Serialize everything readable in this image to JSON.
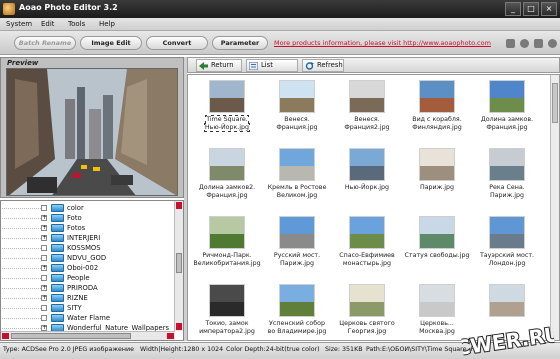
{
  "window": {
    "title": "Aoao Photo Editor 3.2",
    "buttons": [
      "_",
      "□",
      "×"
    ]
  },
  "menu": [
    "System",
    "Edit",
    "Tools",
    "Help"
  ],
  "toolbar": {
    "batch_rename": "Batch Rename",
    "image_edit": "Image Edit",
    "convert": "Convert",
    "parameter": "Parameter",
    "promo_link": "More products information, please visit http://www.aoaophoto.com",
    "icons": [
      "lock-icon",
      "person-icon",
      "home-icon",
      "help-icon"
    ]
  },
  "preview": {
    "label": "Preview"
  },
  "tree": {
    "items": [
      {
        "label": "color",
        "expander": ""
      },
      {
        "label": "Foto",
        "expander": "+"
      },
      {
        "label": "Fotos",
        "expander": "+"
      },
      {
        "label": "INTERJERI",
        "expander": "+"
      },
      {
        "label": "KOSSMOS",
        "expander": ""
      },
      {
        "label": "NDVU_GOD",
        "expander": ""
      },
      {
        "label": "Oboi-002",
        "expander": "+"
      },
      {
        "label": "People",
        "expander": ""
      },
      {
        "label": "PRIRODA",
        "expander": "+"
      },
      {
        "label": "RIZNE",
        "expander": "+"
      },
      {
        "label": "SITY",
        "expander": ""
      },
      {
        "label": "Water Flame",
        "expander": ""
      },
      {
        "label": "Wonderful_Nature_Wallpapers",
        "expander": "+"
      }
    ]
  },
  "browser": {
    "return_label": "Return",
    "list_label": "List",
    "refresh_label": "Refresh"
  },
  "thumbnails": [
    {
      "caption": "Time Square.\nНью-Йорк.jpg",
      "selected": true,
      "sky": "#9fb6cc",
      "ground": "#6b5a4a"
    },
    {
      "caption": "Венеся.\nФранция.jpg",
      "selected": false,
      "sky": "#cfe2f2",
      "ground": "#8c7a5c"
    },
    {
      "caption": "Венеся.\nФранция2.jpg",
      "selected": false,
      "sky": "#d8d8d8",
      "ground": "#7c6a58"
    },
    {
      "caption": "Вид с корабля.\nФинляндия.jpg",
      "selected": false,
      "sky": "#5c8fc4",
      "ground": "#a35c3c"
    },
    {
      "caption": "Долина замков.\nФранция.jpg",
      "selected": false,
      "sky": "#4f86c9",
      "ground": "#6f8d4a"
    },
    {
      "caption": "Долина замков2.\nФранция.jpg",
      "selected": false,
      "sky": "#c9d6e2",
      "ground": "#7f8a6a"
    },
    {
      "caption": "Кремль в Ростове\nВеликом.jpg",
      "selected": false,
      "sky": "#6fa6db",
      "ground": "#b8b8b0"
    },
    {
      "caption": "Нью-Йорк.jpg",
      "selected": false,
      "sky": "#7aa9d6",
      "ground": "#5a6a7c"
    },
    {
      "caption": "Париж.jpg",
      "selected": false,
      "sky": "#e9e2d8",
      "ground": "#9c8f7e"
    },
    {
      "caption": "Река Сена.\nПариж.jpg",
      "selected": false,
      "sky": "#c7ccd2",
      "ground": "#6a7f8c"
    },
    {
      "caption": "Ричмонд-Парк.\nВеликобритания.jpg",
      "selected": false,
      "sky": "#b7c9a2",
      "ground": "#4f7a32"
    },
    {
      "caption": "Русский мост.\nПариж.jpg",
      "selected": false,
      "sky": "#5f99d8",
      "ground": "#8a8a8a"
    },
    {
      "caption": "Спасо-Евфимиев\nмонастырь.jpg",
      "selected": false,
      "sky": "#6aa2dd",
      "ground": "#6c8c4a"
    },
    {
      "caption": "Статуя свободы.jpg",
      "selected": false,
      "sky": "#c8d8e6",
      "ground": "#5f8a6a"
    },
    {
      "caption": "Тауэрский мост.\nЛондон.jpg",
      "selected": false,
      "sky": "#5f97d4",
      "ground": "#6a7c8c"
    },
    {
      "caption": "Токио, замок\nимператора2.jpg",
      "selected": false,
      "sky": "#4a4a4a",
      "ground": "#2a2a2a"
    },
    {
      "caption": "Успенский собор\nво Владимире.jpg",
      "selected": false,
      "sky": "#7aaee0",
      "ground": "#5f7f3a"
    },
    {
      "caption": "Церковь святого\nГеоргия.jpg",
      "selected": false,
      "sky": "#e7e2cf",
      "ground": "#8c9a6a"
    },
    {
      "caption": "Церковь...\nМосква.jpg",
      "selected": false,
      "sky": "#d8dde2",
      "ground": "#c9c9c9"
    },
    {
      "caption": "",
      "selected": false,
      "sky": "#cfd9e2",
      "ground": "#b0a090"
    }
  ],
  "status": {
    "type": "Type: ACDSee Pro 2.0 JPEG изображение",
    "dims": "Width|Height:1280 x 1024",
    "depth": "Color Depth:24-bit(true color)",
    "size": "Size: 351KB",
    "path": "Path:E:\\ОБОИ\\SITY\\Time Square. Нью-Йорк.jpg"
  },
  "watermark": "CWER.RU"
}
